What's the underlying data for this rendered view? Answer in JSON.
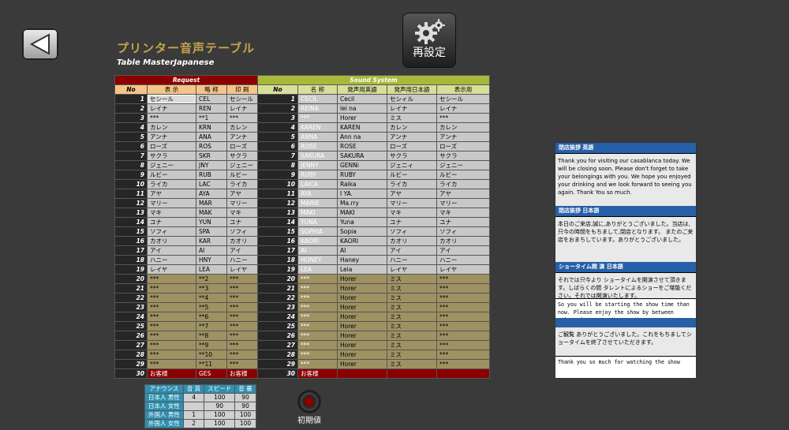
{
  "title_jp": "プリンター音声テーブル",
  "title_en": "Table MasterJapanese",
  "reset_label": "再設定",
  "init_label": "初期値",
  "groups": {
    "request": "Request",
    "sound": "Sound System"
  },
  "headers": {
    "no": "No",
    "display": "表 示",
    "abbr": "略 称",
    "print": "印 刷",
    "no2": "No",
    "name": "名 称",
    "pron_en": "発声用英語",
    "pron_jp": "発声用日本語",
    "show_disp": "表示用"
  },
  "rows": [
    {
      "no": "1",
      "disp": "セシール",
      "abbr": "CEL",
      "print": "セシール",
      "no2": "1",
      "name": "CECIL",
      "en": "Cecil",
      "jp": "セシィル",
      "show": "セシール"
    },
    {
      "no": "2",
      "disp": "レイナ",
      "abbr": "REN",
      "print": "レイナ",
      "no2": "2",
      "name": "REINA",
      "en": "lei na",
      "jp": "レイナ",
      "show": "レイナ"
    },
    {
      "no": "3",
      "disp": "***",
      "abbr": "**1",
      "print": "***",
      "no2": "3",
      "name": "***",
      "en": "Horer",
      "jp": "ミス",
      "show": "***"
    },
    {
      "no": "4",
      "disp": "カレン",
      "abbr": "KRN",
      "print": "カレン",
      "no2": "4",
      "name": "KAREN",
      "en": "KAREN",
      "jp": "カレン",
      "show": "カレン"
    },
    {
      "no": "5",
      "disp": "アンナ",
      "abbr": "ANA",
      "print": "アンナ",
      "no2": "5",
      "name": "ANNA",
      "en": "Ann na",
      "jp": "アンナ",
      "show": "アンナ"
    },
    {
      "no": "6",
      "disp": "ローズ",
      "abbr": "ROS",
      "print": "ローズ",
      "no2": "6",
      "name": "ROSE",
      "en": "ROSE",
      "jp": "ローズ",
      "show": "ローズ"
    },
    {
      "no": "7",
      "disp": "サクラ",
      "abbr": "SKR",
      "print": "サクラ",
      "no2": "7",
      "name": "SAKURA",
      "en": "SAKURA",
      "jp": "サクラ",
      "show": "サクラ"
    },
    {
      "no": "8",
      "disp": "ジェニー",
      "abbr": "JNY",
      "print": "ジェニー",
      "no2": "8",
      "name": "JENNY",
      "en": "GENNi",
      "jp": "ジェニィ",
      "show": "ジェニー"
    },
    {
      "no": "9",
      "disp": "ルビー",
      "abbr": "RUB",
      "print": "ルビー",
      "no2": "9",
      "name": "RUBY",
      "en": "RUBY",
      "jp": "ルビー",
      "show": "ルビー"
    },
    {
      "no": "10",
      "disp": "ライカ",
      "abbr": "LAC",
      "print": "ライカ",
      "no2": "10",
      "name": "LAICA",
      "en": "Raika",
      "jp": "ライカ",
      "show": "ライカ"
    },
    {
      "no": "11",
      "disp": "アヤ",
      "abbr": "AYA",
      "print": "アヤ",
      "no2": "11",
      "name": "AYA",
      "en": "I YA.",
      "jp": "アヤ",
      "show": "アヤ"
    },
    {
      "no": "12",
      "disp": "マリー",
      "abbr": "MAR",
      "print": "マリー",
      "no2": "12",
      "name": "MARIE",
      "en": "Ma.rry",
      "jp": "マリー",
      "show": "マリー"
    },
    {
      "no": "13",
      "disp": "マキ",
      "abbr": "MAK",
      "print": "マキ",
      "no2": "13",
      "name": "MAKI",
      "en": "MAKI",
      "jp": "マキ",
      "show": "マキ"
    },
    {
      "no": "14",
      "disp": "ユナ",
      "abbr": "YUN",
      "print": "ユナ",
      "no2": "14",
      "name": "YUNA",
      "en": "Yuna",
      "jp": "ユナ",
      "show": "ユナ"
    },
    {
      "no": "15",
      "disp": "ソフィ",
      "abbr": "SPA",
      "print": "ソフィ",
      "no2": "15",
      "name": "SOPHIA",
      "en": "Sopia",
      "jp": "ソフィ",
      "show": "ソフィ"
    },
    {
      "no": "16",
      "disp": "カオリ",
      "abbr": "KAR",
      "print": "カオリ",
      "no2": "16",
      "name": "KAORI",
      "en": "KAORI",
      "jp": "カオリ",
      "show": "カオリ"
    },
    {
      "no": "17",
      "disp": "アイ",
      "abbr": "AI",
      "print": "アイ",
      "no2": "17",
      "name": "AI",
      "en": "AI",
      "jp": "アイ",
      "show": "アイ"
    },
    {
      "no": "18",
      "disp": "ハニー",
      "abbr": "HNY",
      "print": "ハニー",
      "no2": "18",
      "name": "HONEY",
      "en": "Haney",
      "jp": "ハニー",
      "show": "ハニー"
    },
    {
      "no": "19",
      "disp": "レイヤ",
      "abbr": "LEA",
      "print": "レイヤ",
      "no2": "19",
      "name": "LEA",
      "en": "Leia",
      "jp": "レイヤ",
      "show": "レイヤ"
    },
    {
      "no": "20",
      "disp": "***",
      "abbr": "**2",
      "print": "***",
      "no2": "20",
      "name": "***",
      "en": "Horer",
      "jp": "ミス",
      "show": "***"
    },
    {
      "no": "21",
      "disp": "***",
      "abbr": "**3",
      "print": "***",
      "no2": "21",
      "name": "***",
      "en": "Horer",
      "jp": "ミス",
      "show": "***"
    },
    {
      "no": "22",
      "disp": "***",
      "abbr": "**4",
      "print": "***",
      "no2": "22",
      "name": "***",
      "en": "Horer",
      "jp": "ミス",
      "show": "***"
    },
    {
      "no": "23",
      "disp": "***",
      "abbr": "**5",
      "print": "***",
      "no2": "23",
      "name": "***",
      "en": "Horer",
      "jp": "ミス",
      "show": "***"
    },
    {
      "no": "24",
      "disp": "***",
      "abbr": "**6",
      "print": "***",
      "no2": "24",
      "name": "***",
      "en": "Horer",
      "jp": "ミス",
      "show": "***"
    },
    {
      "no": "25",
      "disp": "***",
      "abbr": "**7",
      "print": "***",
      "no2": "25",
      "name": "***",
      "en": "Horer",
      "jp": "ミス",
      "show": "***"
    },
    {
      "no": "26",
      "disp": "***",
      "abbr": "**8",
      "print": "***",
      "no2": "26",
      "name": "***",
      "en": "Horer",
      "jp": "ミス",
      "show": "***"
    },
    {
      "no": "27",
      "disp": "***",
      "abbr": "**9",
      "print": "***",
      "no2": "27",
      "name": "***",
      "en": "Horer",
      "jp": "ミス",
      "show": "***"
    },
    {
      "no": "28",
      "disp": "***",
      "abbr": "**10",
      "print": "***",
      "no2": "28",
      "name": "***",
      "en": "Horer",
      "jp": "ミス",
      "show": "***"
    },
    {
      "no": "29",
      "disp": "***",
      "abbr": "**11",
      "print": "***",
      "no2": "29",
      "name": "***",
      "en": "Horer",
      "jp": "ミス",
      "show": "***"
    },
    {
      "no": "30",
      "disp": "お客様",
      "abbr": "GES",
      "print": "お客様",
      "no2": "30",
      "name": "お客様",
      "en": "",
      "jp": "",
      "show": ""
    }
  ],
  "announce": {
    "headers": [
      "アナウンス",
      "音 質",
      "スピード",
      "音 量"
    ],
    "rows": [
      {
        "label": "日本人 男性",
        "q": "4",
        "s": "100",
        "v": "90"
      },
      {
        "label": "日本人 女性",
        "q": "",
        "s": "90",
        "v": "90"
      },
      {
        "label": "外国人 男性",
        "q": "1",
        "s": "100",
        "v": "100"
      },
      {
        "label": "外国人 女性",
        "q": "2",
        "s": "100",
        "v": "100"
      }
    ]
  },
  "panel": {
    "h1": "閉店挨拶 英語",
    "t1": "Thank you for visiting our casablanca today. We will be closing soon. Please don't forget to take your belongings with you. We hope you enjoyed your drinking and we look forward to seeing you again. Thank You so much.",
    "h2": "閉店挨拶 日本語",
    "t2": "本日のご来店,誠に,ありがとうございました。当店は,只今の時間をもちまして,閉店となります。 またのご来店をおまちしています。ありがとうございました。",
    "h3": "ショータイム開 演 日本語",
    "t3": "それでは只今より ショータイムを開演させて頂きます。しばらくの間 タレントによるショーをご堪能ください。それでは開演いたします。",
    "t4": "So you will be starting the show time than now. Please enjoy the show by between talent for some time. Ladies",
    "t5": "ご観覧 ありがとうございました。これをもちましてショータイムを終了させていただきます。",
    "t6": "Thank you so much for watching the show"
  },
  "colors": {
    "request": "#8b0000",
    "sound": "#a9b83a",
    "panel_head": "#2660a8",
    "title": "#c4a54a"
  }
}
